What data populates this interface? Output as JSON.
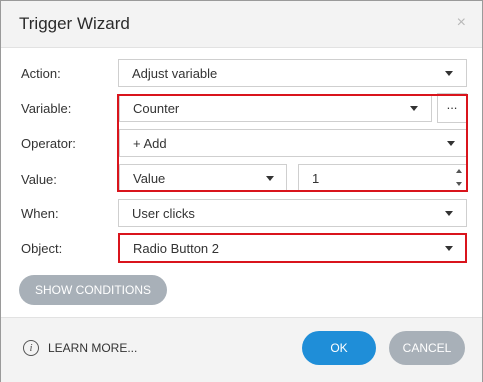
{
  "window": {
    "title": "Trigger Wizard",
    "close_glyph": "×"
  },
  "form": {
    "action": {
      "label": "Action:",
      "value": "Adjust variable"
    },
    "variable": {
      "label": "Variable:",
      "value": "Counter",
      "browse_label": "..."
    },
    "operator": {
      "label": "Operator:",
      "value": "+ Add"
    },
    "value": {
      "label": "Value:",
      "type_value": "Value",
      "number_value": "1"
    },
    "when": {
      "label": "When:",
      "value": "User clicks"
    },
    "object": {
      "label": "Object:",
      "value": "Radio Button 2"
    }
  },
  "buttons": {
    "show_conditions": "SHOW CONDITIONS",
    "learn_more": "LEARN MORE...",
    "ok": "OK",
    "cancel": "CANCEL"
  },
  "icons": {
    "info": "info-icon",
    "dropdown": "chevron-down-icon",
    "close": "close-icon"
  },
  "colors": {
    "accent": "#1f8ed8",
    "highlight_border": "#d9141c",
    "secondary_button": "#a8b0b8"
  }
}
